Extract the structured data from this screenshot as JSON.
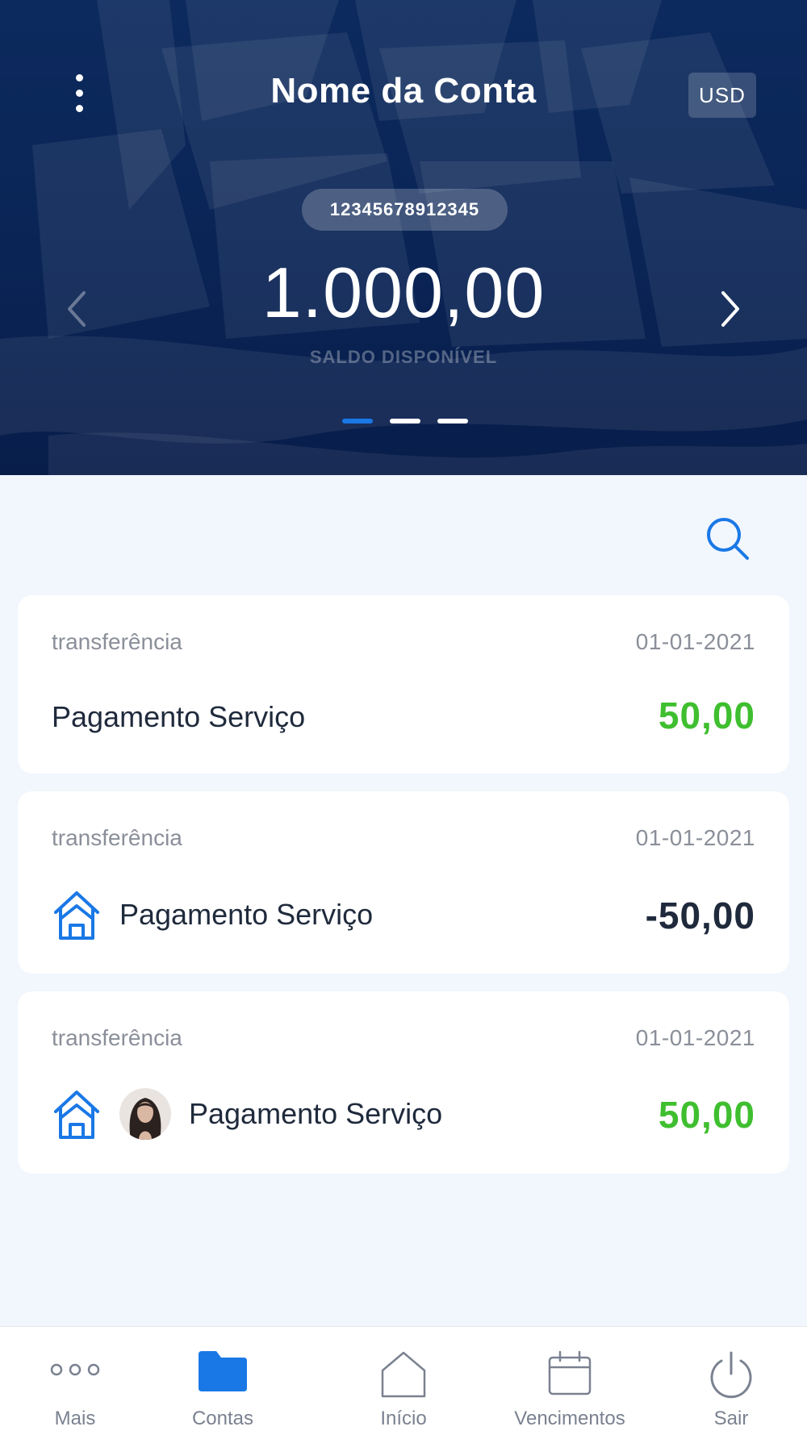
{
  "header": {
    "account_name": "Nome da Conta",
    "currency": "USD",
    "account_number": "12345678912345",
    "balance": "1.000,00",
    "balance_label": "SALDO DISPONÍVEL",
    "pager": {
      "pages": 3,
      "active_index": 0
    }
  },
  "search": {
    "icon": "search-icon"
  },
  "transactions": [
    {
      "type": "transferência",
      "date": "01-01-2021",
      "title": "Pagamento Serviço",
      "amount": "50,00",
      "amount_sign": "positive",
      "icons": []
    },
    {
      "type": "transferência",
      "date": "01-01-2021",
      "title": "Pagamento Serviço",
      "amount": "-50,00",
      "amount_sign": "negative",
      "icons": [
        "house-icon"
      ]
    },
    {
      "type": "transferência",
      "date": "01-01-2021",
      "title": "Pagamento Serviço",
      "amount": "50,00",
      "amount_sign": "positive",
      "icons": [
        "house-icon",
        "avatar"
      ]
    }
  ],
  "tabbar": {
    "items": [
      {
        "label": "Mais",
        "icon": "more-icon",
        "active": false
      },
      {
        "label": "Contas",
        "icon": "folder-icon",
        "active": true
      },
      {
        "label": "Início",
        "icon": "home-icon",
        "active": false
      },
      {
        "label": "Vencimentos",
        "icon": "calendar-icon",
        "active": false
      },
      {
        "label": "Sair",
        "icon": "power-icon",
        "active": false
      }
    ]
  },
  "colors": {
    "header_background": "#0a2455",
    "accent_blue": "#1a78e6",
    "amount_positive": "#3fbf2f",
    "amount_negative": "#1f2a3c",
    "page_background": "#f2f6fd"
  }
}
